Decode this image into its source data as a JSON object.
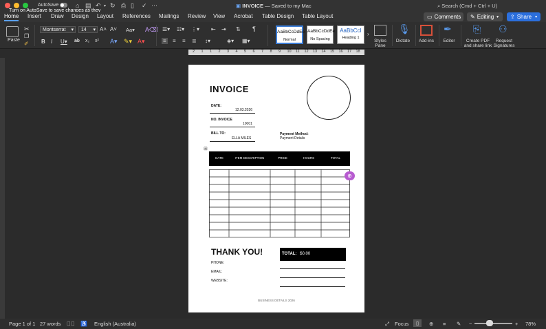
{
  "titlebar": {
    "autosave_label": "AutoSave",
    "autosave_tooltip": "Turn on AutoSave to save changes as they happen.",
    "doc_name": "INVOICE",
    "doc_status": "— Saved to my Mac",
    "search_placeholder": "Search (Cmd + Ctrl + U)"
  },
  "menu": {
    "tabs": [
      "Home",
      "Insert",
      "Draw",
      "Design",
      "Layout",
      "References",
      "Mailings",
      "Review",
      "View",
      "Acrobat",
      "Table Design",
      "Table Layout"
    ],
    "comments_label": "Comments",
    "editing_label": "Editing",
    "share_label": "Share"
  },
  "ribbon": {
    "paste_label": "Paste",
    "font_name": "Montserrat",
    "font_size": "14",
    "styles": [
      {
        "preview": "AaBbCcDdEe",
        "name": "Normal"
      },
      {
        "preview": "AaBbCcDdEe",
        "name": "No Spacing"
      },
      {
        "preview": "AaBbCcI",
        "name": "Heading 1"
      }
    ],
    "styles_pane_label": "Styles Pane",
    "dictate_label": "Dictate",
    "addins_label": "Add-ins",
    "editor_label": "Editor",
    "create_pdf_label": "Create PDF and share link",
    "request_sig_label": "Request Signatures",
    "icons": {
      "paste": "clipboard-icon",
      "dictate": "microphone-icon",
      "addins": "grid-icon",
      "editor": "pen-icon",
      "pdf": "acrobat-icon",
      "signature": "person-icon"
    }
  },
  "ruler": {
    "marks": [
      "2",
      "1",
      "1",
      "2",
      "3",
      "4",
      "5",
      "6",
      "7",
      "8",
      "9",
      "10",
      "11",
      "12",
      "13",
      "14",
      "15",
      "16",
      "17",
      "18"
    ]
  },
  "document": {
    "title": "INVOICE",
    "date_label": "DATE:",
    "date_value": "12.03.2026",
    "invoice_no_label": "NO. INVOICE",
    "invoice_no_value": "10001",
    "bill_to_label": "BILL TO:",
    "bill_to_value": "ELLA MILES",
    "payment_method_label": "Payment Method:",
    "payment_method_value": "Payment Details",
    "table_headers": [
      "DATE",
      "ITEM DESCRIPTION",
      "PRICE",
      "HOURS",
      "TOTAL"
    ],
    "thank_you": "THANK YOU!",
    "total_label": "TOTAL:",
    "total_value": "$0.00",
    "phone_label": "PHONE:",
    "email_label": "EMAIL:",
    "website_label": "WEBSITE:",
    "footer": "BUSINESS DETAILS 2026"
  },
  "status": {
    "page": "Page 1 of 1",
    "words": "27 words",
    "language": "English (Australia)",
    "focus": "Focus",
    "zoom": "78%",
    "zoom_level": 0.78
  }
}
